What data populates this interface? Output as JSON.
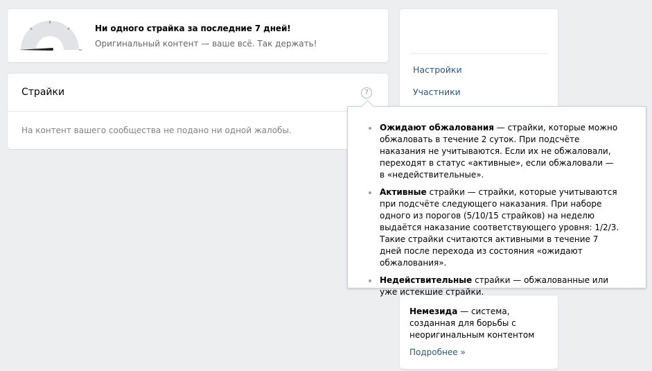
{
  "status": {
    "title": "Ни одного страйка за последние 7 дней!",
    "subtitle": "Оригинальный контент — ваше всё. Так держать!",
    "gauge_level": 0
  },
  "strikes": {
    "title": "Страйки",
    "help_glyph": "?",
    "empty_text": "На контент вашего сообщества не подано ни одной жалобы."
  },
  "menu": {
    "items": [
      {
        "label": "Настройки"
      },
      {
        "label": "Участники"
      }
    ]
  },
  "tooltip": {
    "items": [
      {
        "term": "Ожидают обжалования",
        "text": " — страйки, которые можно обжаловать в течение 2 суток. При подсчёте наказания не учитываются. Если их не обжаловали, переходят в статус «активные», если обжаловали — в «недействительные»."
      },
      {
        "term": "Активные",
        "text": " страйки — страйки, которые учитываются при подсчёте следующего наказания. При наборе одного из порогов (5/10/15 страйков) на неделю выдаётся наказание соответствующего уровня: 1/2/3. Такие страйки считаются активными в течение 7 дней после перехода из состояния «ожидают обжалования»."
      },
      {
        "term": "Недействительные",
        "text": " страйки — обжалованные или уже истекшие страйки."
      }
    ]
  },
  "info": {
    "term": "Немезида",
    "text": " — система, созданная для борьбы с неоригинальным контентом",
    "link": "Подробнее »"
  },
  "colors": {
    "background": "#edeef0",
    "link": "#2a5885",
    "gauge_arc": "#e1e3e6",
    "gauge_needle": "#222222"
  }
}
